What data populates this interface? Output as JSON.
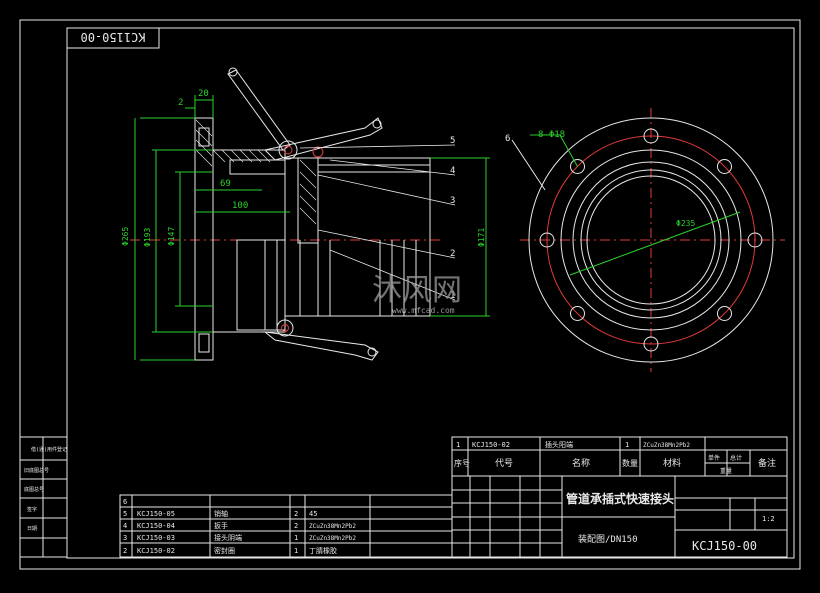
{
  "title_block": {
    "drawing_code_rotated": "KC1150-00",
    "product_title": "管道承插式快速接头",
    "subtitle": "装配图/DN150",
    "drawing_number": "KCJ150-00",
    "scale": "1:2",
    "header": {
      "seq": "序号",
      "code": "代号",
      "name": "名称",
      "qty": "数量",
      "material": "材料",
      "unit_weight": "单件",
      "total_weight": "总计",
      "weight": "重量",
      "remark": "备注"
    },
    "top_row": {
      "seq": "1",
      "code": "KCJ150-02",
      "name": "插头阳端",
      "qty": "1",
      "material": "ZCuZn38Mn2Pb2"
    }
  },
  "left_strip": [
    "借(通)用件登记",
    "旧底图总号",
    "底图总号",
    "签字",
    "日期"
  ],
  "bom_rows": [
    {
      "seq": "6",
      "code": "",
      "name": "",
      "qty": "",
      "material": ""
    },
    {
      "seq": "5",
      "code": "KCJ150-05",
      "name": "销轴",
      "qty": "2",
      "material": "45"
    },
    {
      "seq": "4",
      "code": "KCJ150-04",
      "name": "扳手",
      "qty": "2",
      "material": "ZCuZn38Mn2Pb2"
    },
    {
      "seq": "3",
      "code": "KCJ150-03",
      "name": "接头阴端",
      "qty": "1",
      "material": "ZCuZn38Mn2Pb2"
    },
    {
      "seq": "2",
      "code": "KCJ150-02",
      "name": "密封圈",
      "qty": "1",
      "material": "丁腈橡胶"
    }
  ],
  "dimensions": {
    "top_20": "20",
    "top_2": "2",
    "d69": "69",
    "d100": "100",
    "dia265": "Φ265",
    "dia193": "Φ193",
    "dia147": "Φ147",
    "dia171": "Φ171",
    "holes": "8-Φ18",
    "pcd": "Φ235"
  },
  "callouts": [
    "5",
    "4",
    "3",
    "2",
    "1",
    "6"
  ],
  "watermark": {
    "text": "沐风网",
    "url": "www.mfcad.com"
  },
  "colors": {
    "line": "#e8e8e8",
    "center": "#e03a3a",
    "dimension": "#2ad12a",
    "background": "#000000"
  }
}
